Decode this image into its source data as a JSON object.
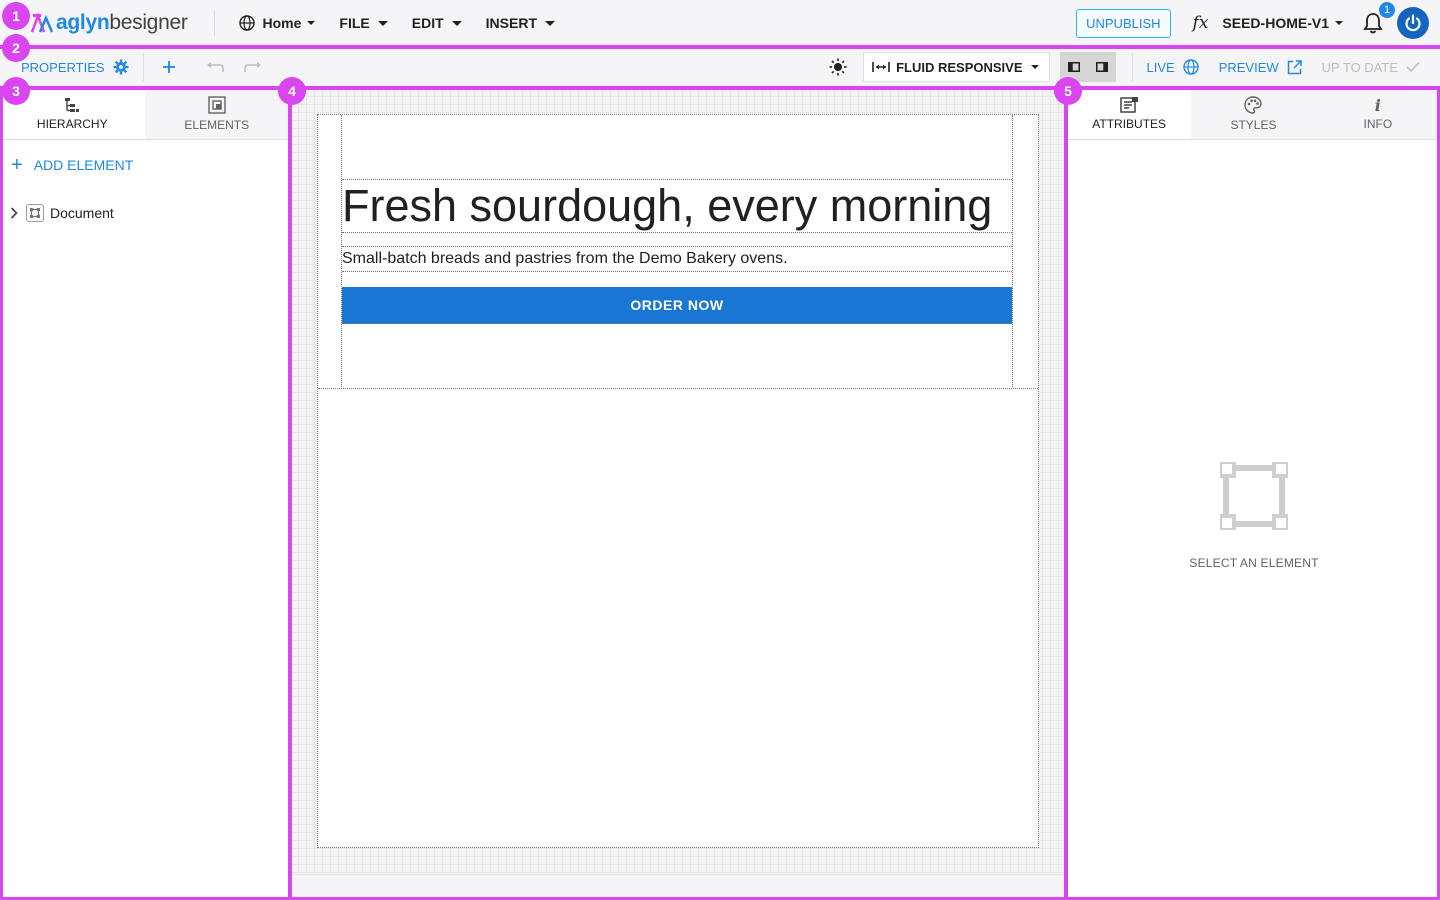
{
  "app": {
    "logo_brand": "aglyn",
    "logo_product": "besigner"
  },
  "topmenu": {
    "page": "Home",
    "file": "FILE",
    "edit": "EDIT",
    "insert": "INSERT"
  },
  "topright": {
    "unpublish": "UNPUBLISH",
    "fx": "fx",
    "version": "SEED-HOME-V1",
    "notifications_count": "1"
  },
  "toolbar": {
    "properties": "PROPERTIES",
    "responsive": "FLUID RESPONSIVE",
    "live": "LIVE",
    "preview": "PREVIEW",
    "up_to_date": "UP TO DATE"
  },
  "leftpanel": {
    "tabs": [
      {
        "label": "HIERARCHY",
        "icon": "hierarchy-icon",
        "active": true
      },
      {
        "label": "ELEMENTS",
        "icon": "elements-icon",
        "active": false
      }
    ],
    "add_element": "ADD ELEMENT",
    "tree": [
      {
        "label": "Document",
        "icon": "document-icon",
        "expanded": false
      }
    ]
  },
  "canvas": {
    "heading": "Fresh sourdough, every morning",
    "subtext": "Small-batch breads and pastries from the Demo Bakery ovens.",
    "button": "ORDER NOW"
  },
  "rightpanel": {
    "tabs": [
      {
        "label": "ATTRIBUTES",
        "icon": "attributes-icon",
        "active": true
      },
      {
        "label": "STYLES",
        "icon": "palette-icon",
        "active": false
      },
      {
        "label": "INFO",
        "icon": "info-icon",
        "active": false
      }
    ],
    "empty_label": "SELECT AN ELEMENT"
  },
  "annotations": [
    "1",
    "2",
    "3",
    "4",
    "5"
  ],
  "colors": {
    "accent": "#1e88e5",
    "button": "#1976d2",
    "annotation": "#d946ef"
  }
}
